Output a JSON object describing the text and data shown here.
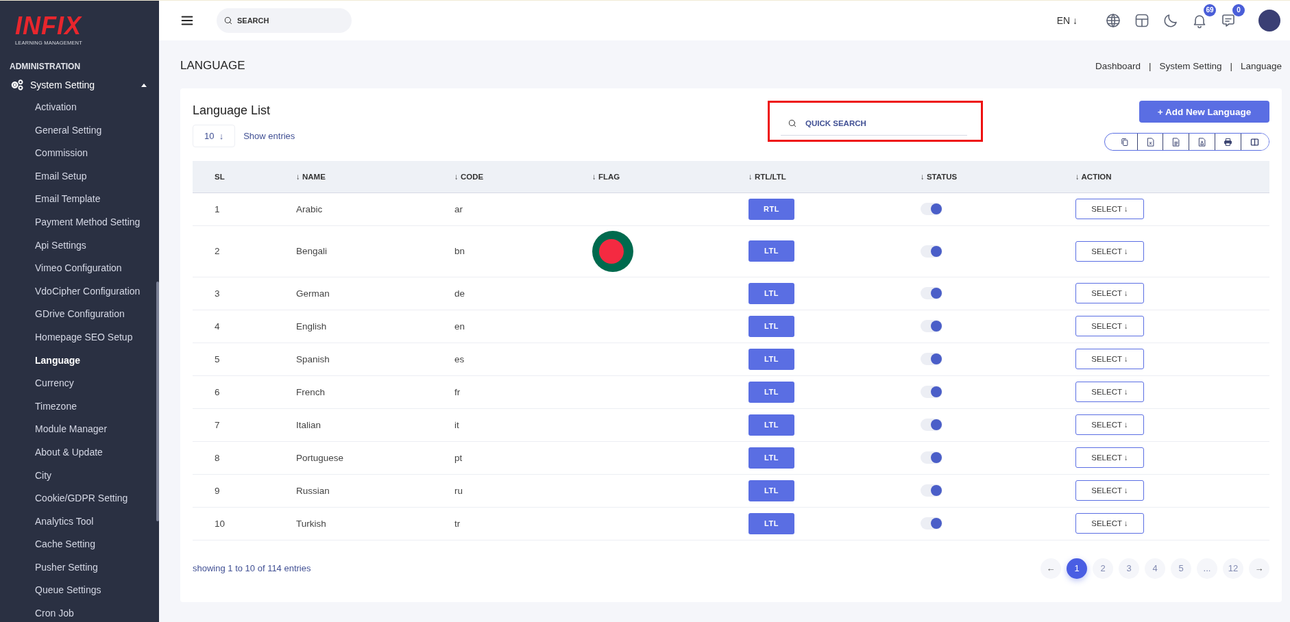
{
  "sidebar": {
    "logo": "INFIX",
    "logo_subtitle": "LEARNING MANAGEMENT",
    "section": "ADMINISTRATION",
    "group": {
      "label": "System Setting",
      "expanded": true
    },
    "items": [
      {
        "label": "Activation",
        "selected": false
      },
      {
        "label": "General Setting",
        "selected": false
      },
      {
        "label": "Commission",
        "selected": false
      },
      {
        "label": "Email Setup",
        "selected": false
      },
      {
        "label": "Email Template",
        "selected": false
      },
      {
        "label": "Payment Method Setting",
        "selected": false
      },
      {
        "label": "Api Settings",
        "selected": false
      },
      {
        "label": "Vimeo Configuration",
        "selected": false
      },
      {
        "label": "VdoCipher Configuration",
        "selected": false
      },
      {
        "label": "GDrive Configuration",
        "selected": false
      },
      {
        "label": "Homepage SEO Setup",
        "selected": false
      },
      {
        "label": "Language",
        "selected": true
      },
      {
        "label": "Currency",
        "selected": false
      },
      {
        "label": "Timezone",
        "selected": false
      },
      {
        "label": "Module Manager",
        "selected": false
      },
      {
        "label": "About & Update",
        "selected": false
      },
      {
        "label": "City",
        "selected": false
      },
      {
        "label": "Cookie/GDPR Setting",
        "selected": false
      },
      {
        "label": "Analytics Tool",
        "selected": false
      },
      {
        "label": "Cache Setting",
        "selected": false
      },
      {
        "label": "Pusher Setting",
        "selected": false
      },
      {
        "label": "Queue Settings",
        "selected": false
      },
      {
        "label": "Cron Job",
        "selected": false
      }
    ]
  },
  "topbar": {
    "search_placeholder": "SEARCH",
    "language": "EN",
    "language_arrow": "↓",
    "notifications": "69",
    "messages": "0"
  },
  "page": {
    "title": "LANGUAGE",
    "breadcrumbs": [
      "Dashboard",
      "System Setting",
      "Language"
    ],
    "separator": "|"
  },
  "card": {
    "title": "Language List",
    "add_button": "+ Add New Language",
    "page_size": "10",
    "page_size_arrow": "↓",
    "show_entries": "Show entries",
    "quick_search_placeholder": "QUICK SEARCH",
    "search_highlighted": true,
    "export_buttons": [
      {
        "kind": "copy"
      },
      {
        "kind": "excel"
      },
      {
        "kind": "csv"
      },
      {
        "kind": "pdf"
      },
      {
        "kind": "print"
      },
      {
        "kind": "columns"
      }
    ]
  },
  "table": {
    "columns": [
      "SL",
      "↓ NAME",
      "↓ CODE",
      "↓ FLAG",
      "↓ RTL/LTL",
      "↓ STATUS",
      "↓ ACTION"
    ],
    "rows": [
      {
        "sl": "1",
        "name": "Arabic",
        "code": "ar",
        "direction": "RTL",
        "on": true,
        "action": "SELECT ↓"
      },
      {
        "sl": "2",
        "name": "Bengali",
        "code": "bn",
        "flag": {
          "kind": "bangladesh"
        },
        "direction": "LTL",
        "on": true,
        "action": "SELECT ↓"
      },
      {
        "sl": "3",
        "name": "German",
        "code": "de",
        "direction": "LTL",
        "on": true,
        "action": "SELECT ↓"
      },
      {
        "sl": "4",
        "name": "English",
        "code": "en",
        "direction": "LTL",
        "on": true,
        "action": "SELECT ↓"
      },
      {
        "sl": "5",
        "name": "Spanish",
        "code": "es",
        "direction": "LTL",
        "on": true,
        "action": "SELECT ↓"
      },
      {
        "sl": "6",
        "name": "French",
        "code": "fr",
        "direction": "LTL",
        "on": true,
        "action": "SELECT ↓"
      },
      {
        "sl": "7",
        "name": "Italian",
        "code": "it",
        "direction": "LTL",
        "on": true,
        "action": "SELECT ↓"
      },
      {
        "sl": "8",
        "name": "Portuguese",
        "code": "pt",
        "direction": "LTL",
        "on": true,
        "action": "SELECT ↓"
      },
      {
        "sl": "9",
        "name": "Russian",
        "code": "ru",
        "direction": "LTL",
        "on": true,
        "action": "SELECT ↓"
      },
      {
        "sl": "10",
        "name": "Turkish",
        "code": "tr",
        "direction": "LTL",
        "on": true,
        "action": "SELECT ↓"
      }
    ]
  },
  "footer": {
    "info": "showing 1 to 10 of 114 entries",
    "prev": "←",
    "next": "→",
    "pages": [
      {
        "label": "1",
        "selected": true
      },
      {
        "label": "2",
        "selected": false
      },
      {
        "label": "3",
        "selected": false
      },
      {
        "label": "4",
        "selected": false
      },
      {
        "label": "5",
        "selected": false
      },
      {
        "label": "...",
        "selected": false
      },
      {
        "label": "12",
        "selected": false
      }
    ]
  }
}
